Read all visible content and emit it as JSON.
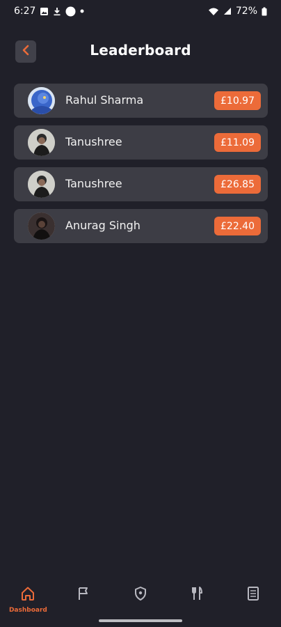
{
  "status_bar": {
    "time": "6:27",
    "battery": "72%"
  },
  "header": {
    "title": "Leaderboard"
  },
  "leaderboard": [
    {
      "name": "Rahul Sharma",
      "amount": "£10.97"
    },
    {
      "name": "Tanushree",
      "amount": "£11.09"
    },
    {
      "name": "Tanushree",
      "amount": "£26.85"
    },
    {
      "name": "Anurag Singh",
      "amount": "£22.40"
    }
  ],
  "bottom_nav": {
    "items": [
      {
        "label": "Dashboard",
        "icon": "home-icon",
        "active": true
      },
      {
        "label": "",
        "icon": "flag-icon"
      },
      {
        "label": "",
        "icon": "shield-icon"
      },
      {
        "label": "",
        "icon": "fork-knife-icon"
      },
      {
        "label": "",
        "icon": "document-icon"
      }
    ]
  },
  "colors": {
    "background": "#202029",
    "card": "#3d3d45",
    "accent": "#ec6b39",
    "text": "#ffffff",
    "inactive_icon": "#b8b8c0"
  }
}
